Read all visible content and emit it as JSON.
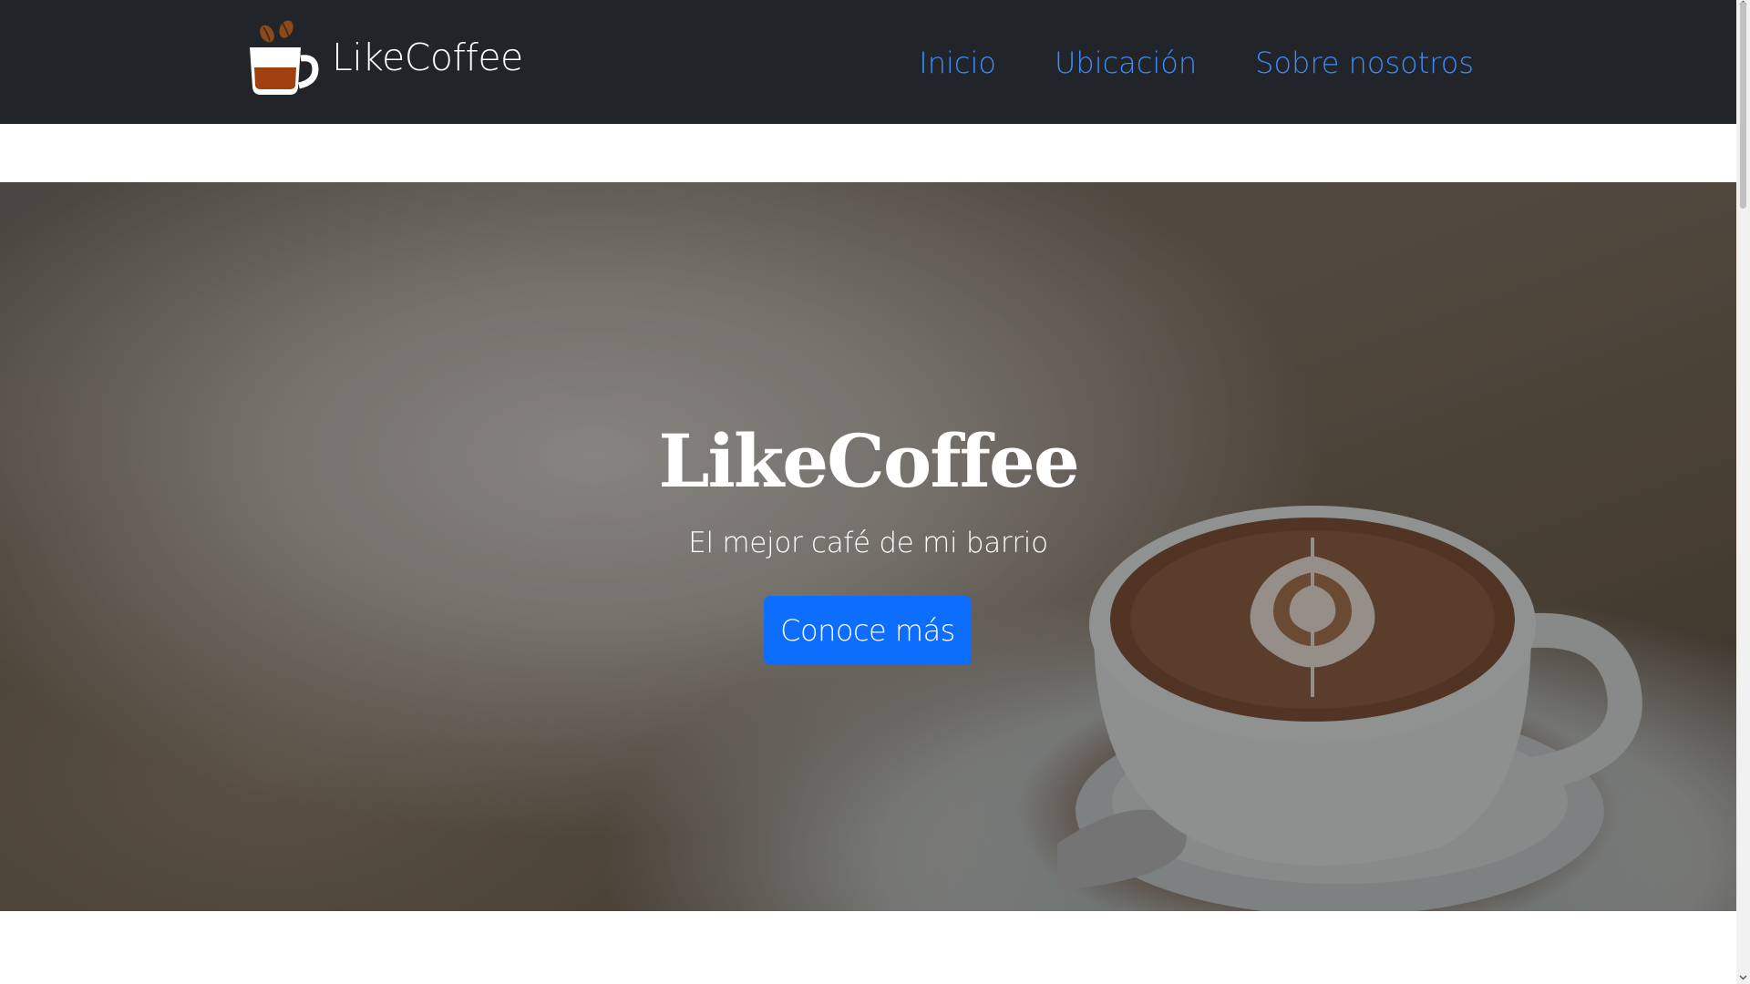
{
  "navbar": {
    "brand_name": "LikeCoffee",
    "brand_logo_icon": "coffee-cup-logo-icon",
    "links": [
      {
        "label": "Inicio"
      },
      {
        "label": "Ubicación"
      },
      {
        "label": "Sobre nosotros"
      }
    ],
    "colors": {
      "background": "#212529",
      "link": "#3d8bfd"
    }
  },
  "hero": {
    "title": "LikeCoffee",
    "subtitle": "El mejor café de mi barrio",
    "button_label": "Conoce más",
    "background_image": "latte-art-coffee-cup-photo",
    "colors": {
      "button": "#0d6efd",
      "text": "#ffffff"
    }
  }
}
